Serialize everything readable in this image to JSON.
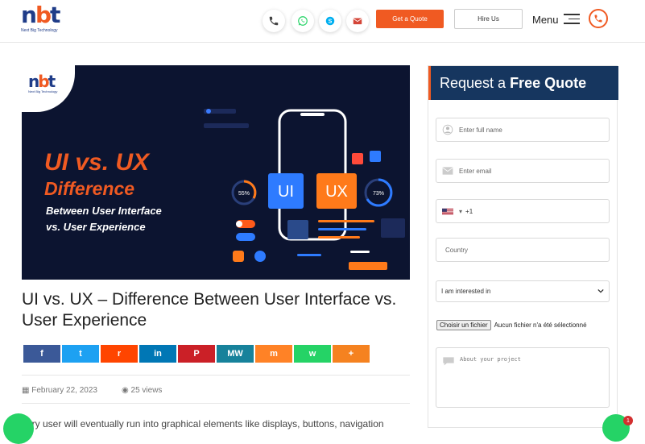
{
  "header": {
    "logo_text": "nbt",
    "logo_tagline": "Next Big Technology",
    "quote_button": "Get a Quote",
    "hire_button": "Hire Us",
    "menu_label": "Menu"
  },
  "hero": {
    "badge_logo": "nbt",
    "badge_tagline": "Next Big Technology",
    "line1": "UI vs. UX",
    "line2": "Difference",
    "line3": "Between User Interface",
    "line4": "vs. User Experience",
    "ui_label": "UI",
    "ux_label": "UX",
    "pct_left": "55%",
    "pct_right": "73%"
  },
  "article": {
    "title": "UI vs. UX – Difference Between User Interface vs. User Experience",
    "date": "February 22, 2023",
    "views": "25 views",
    "body_start": "very user will eventually run into graphical elements like displays, buttons, navigation"
  },
  "share_buttons": [
    {
      "icon": "facebook-icon",
      "glyph": "f",
      "color": "#3b5998"
    },
    {
      "icon": "twitter-icon",
      "glyph": "t",
      "color": "#1da1f2"
    },
    {
      "icon": "reddit-icon",
      "glyph": "r",
      "color": "#ff4500"
    },
    {
      "icon": "linkedin-icon",
      "glyph": "in",
      "color": "#0077b5"
    },
    {
      "icon": "pinterest-icon",
      "glyph": "P",
      "color": "#cb2027"
    },
    {
      "icon": "mewe-icon",
      "glyph": "MW",
      "color": "#17829b"
    },
    {
      "icon": "mix-icon",
      "glyph": "m",
      "color": "#ff8226"
    },
    {
      "icon": "whatsapp-icon",
      "glyph": "w",
      "color": "#25d366"
    },
    {
      "icon": "more-icon",
      "glyph": "+",
      "color": "#f58220"
    }
  ],
  "form": {
    "heading_normal": "Request a ",
    "heading_bold": "Free Quote",
    "name_placeholder": "Enter full name",
    "email_placeholder": "Enter email",
    "phone_code": "+1",
    "country_placeholder": "Country",
    "interest_select": "I am interested in",
    "file_button": "Choisir un fichier",
    "file_status": "Aucun fichier n'a été sélectionné",
    "project_placeholder": "About your project"
  },
  "chat_badge": "1",
  "colors": {
    "accent": "#f05a22",
    "navy": "#16365f",
    "hero_bg": "#0c1430"
  }
}
